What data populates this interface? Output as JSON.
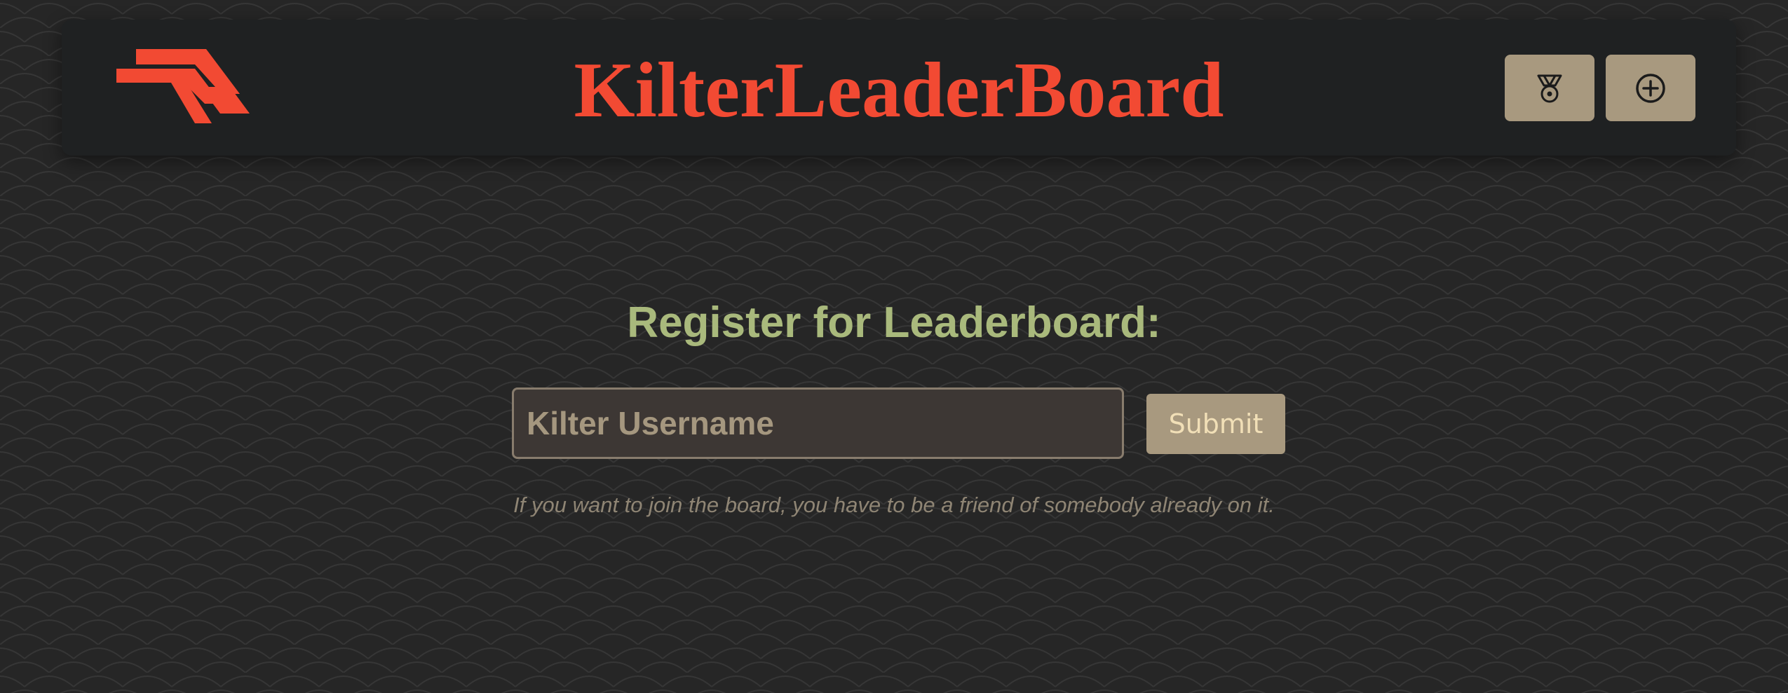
{
  "header": {
    "title": "KilterLeaderBoard",
    "logo_icon": "kilter-logo-icon",
    "buttons": [
      {
        "icon": "medal-icon"
      },
      {
        "icon": "plus-circle-icon"
      }
    ]
  },
  "register": {
    "title": "Register for Leaderboard:",
    "username_placeholder": "Kilter Username",
    "username_value": "",
    "submit_label": "Submit",
    "note": "If you want to join the board, you have to be a friend of somebody already on it."
  },
  "colors": {
    "background": "#262626",
    "header_bg": "#1f2122",
    "accent": "#f24a33",
    "heading": "#a9b97c",
    "button": "#a8997f",
    "submit_text": "#f1dfb7",
    "note_text": "#8f8574"
  }
}
